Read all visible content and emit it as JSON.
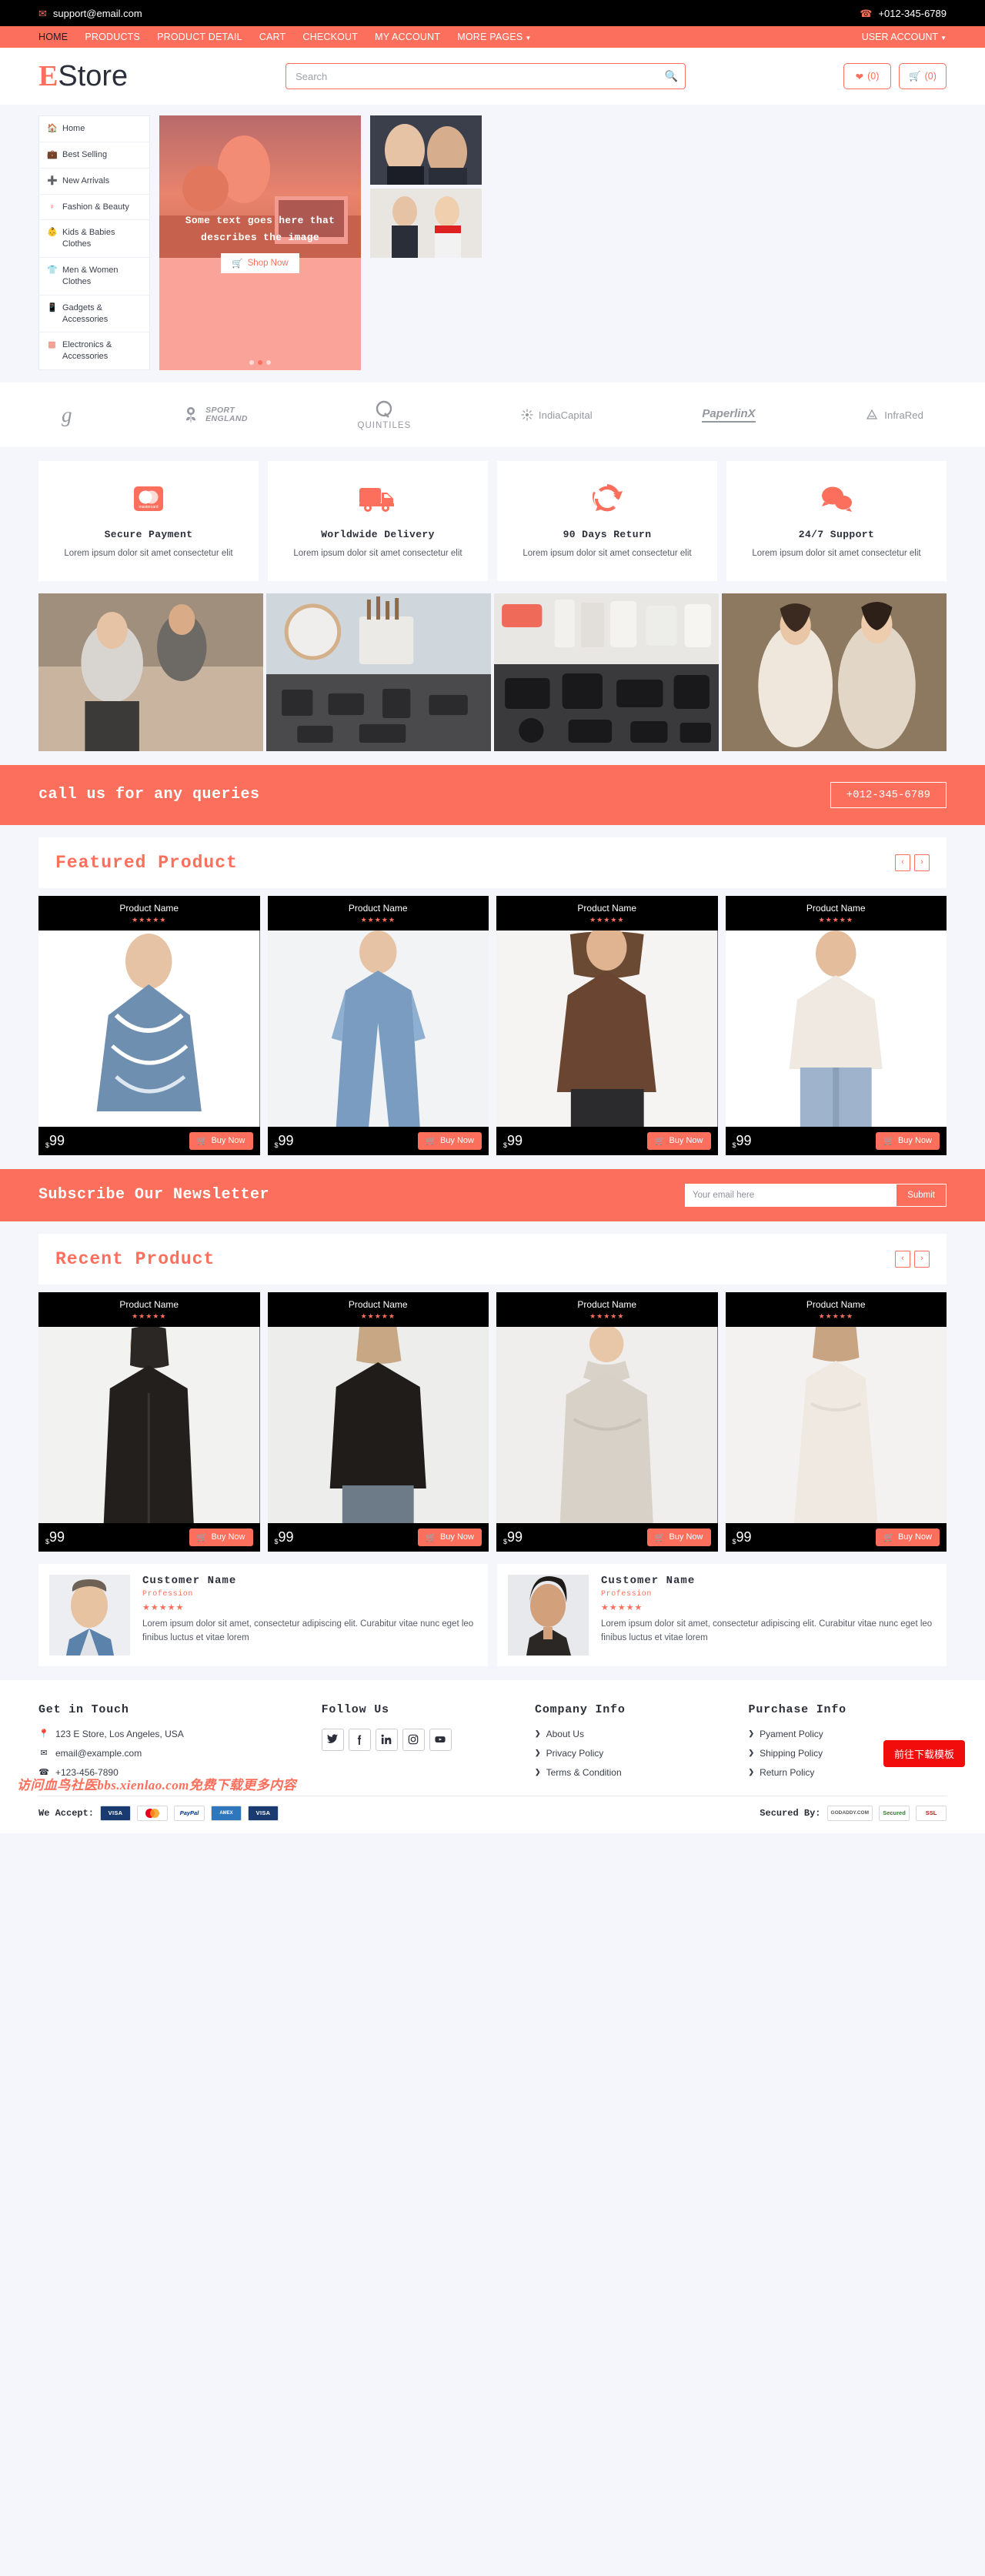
{
  "topbar": {
    "email": "support@email.com",
    "phone": "+012-345-6789",
    "email_icon": "envelope-icon",
    "phone_icon": "phone-icon"
  },
  "nav": {
    "links": [
      {
        "label": "HOME",
        "active": true
      },
      {
        "label": "PRODUCTS",
        "active": false
      },
      {
        "label": "PRODUCT DETAIL",
        "active": false
      },
      {
        "label": "CART",
        "active": false
      },
      {
        "label": "CHECKOUT",
        "active": false
      },
      {
        "label": "MY ACCOUNT",
        "active": false
      },
      {
        "label": "MORE PAGES",
        "active": false,
        "caret": true
      }
    ],
    "user_account": "USER ACCOUNT"
  },
  "header": {
    "logo_first": "E",
    "logo_rest": "Store",
    "search_placeholder": "Search",
    "search_value": "",
    "wishlist_count": "(0)",
    "cart_count": "(0)"
  },
  "categories": [
    {
      "label": "Home",
      "icon": "home-icon"
    },
    {
      "label": "Best Selling",
      "icon": "bag-icon"
    },
    {
      "label": "New Arrivals",
      "icon": "plus-square-icon"
    },
    {
      "label": "Fashion & Beauty",
      "icon": "female-icon"
    },
    {
      "label": "Kids & Babies Clothes",
      "icon": "child-icon"
    },
    {
      "label": "Men & Women Clothes",
      "icon": "tshirt-icon"
    },
    {
      "label": "Gadgets & Accessories",
      "icon": "mobile-icon"
    },
    {
      "label": "Electronics & Accessories",
      "icon": "microchip-icon"
    }
  ],
  "hero": {
    "text": "Some text goes here that describes the image",
    "cta": "Shop Now",
    "cta_icon": "cart-icon",
    "dots": 3,
    "active_dot": 2
  },
  "brands": [
    {
      "name": "",
      "kind": "script",
      "glyph": "g"
    },
    {
      "name": "SPORT ENGLAND",
      "kind": "sport"
    },
    {
      "name": "QUINTILES",
      "kind": "quintiles"
    },
    {
      "name": "IndiaCapital",
      "kind": "plain"
    },
    {
      "name": "PaperlinX",
      "kind": "paperlinx"
    },
    {
      "name": "InfraRed",
      "kind": "infrared"
    }
  ],
  "features": [
    {
      "title": "Secure Payment",
      "desc": "Lorem ipsum dolor sit amet consectetur elit",
      "icon": "mastercard-icon"
    },
    {
      "title": "Worldwide Delivery",
      "desc": "Lorem ipsum dolor sit amet consectetur elit",
      "icon": "truck-icon"
    },
    {
      "title": "90 Days Return",
      "desc": "Lorem ipsum dolor sit amet consectetur elit",
      "icon": "refresh-icon"
    },
    {
      "title": "24/7 Support",
      "desc": "Lorem ipsum dolor sit amet consectetur elit",
      "icon": "comments-icon"
    }
  ],
  "tiles": [
    {
      "name": "women-fashion-tile"
    },
    {
      "name": "beauty-makeup-tile"
    },
    {
      "name": "gadgets-electronics-tile"
    },
    {
      "name": "dresses-tile"
    }
  ],
  "call_banner": {
    "text": "call us for any queries",
    "phone": "+012-345-6789"
  },
  "featured": {
    "title": "Featured Product",
    "prev": "‹",
    "next": "›",
    "products": [
      {
        "name": "Product Name",
        "stars": "★★★★★",
        "currency": "$",
        "price": "99",
        "buy": "Buy Now"
      },
      {
        "name": "Product Name",
        "stars": "★★★★★",
        "currency": "$",
        "price": "99",
        "buy": "Buy Now"
      },
      {
        "name": "Product Name",
        "stars": "★★★★★",
        "currency": "$",
        "price": "99",
        "buy": "Buy Now"
      },
      {
        "name": "Product Name",
        "stars": "★★★★★",
        "currency": "$",
        "price": "99",
        "buy": "Buy Now"
      }
    ]
  },
  "newsletter": {
    "title": "Subscribe Our Newsletter",
    "placeholder": "Your email here",
    "value": "",
    "submit": "Submit"
  },
  "recent": {
    "title": "Recent Product",
    "prev": "‹",
    "next": "›",
    "products": [
      {
        "name": "Product Name",
        "stars": "★★★★★",
        "currency": "$",
        "price": "99",
        "buy": "Buy Now"
      },
      {
        "name": "Product Name",
        "stars": "★★★★★",
        "currency": "$",
        "price": "99",
        "buy": "Buy Now"
      },
      {
        "name": "Product Name",
        "stars": "★★★★★",
        "currency": "$",
        "price": "99",
        "buy": "Buy Now"
      },
      {
        "name": "Product Name",
        "stars": "★★★★★",
        "currency": "$",
        "price": "99",
        "buy": "Buy Now"
      }
    ]
  },
  "testimonials": [
    {
      "name": "Customer Name",
      "profession": "Profession",
      "stars": "★★★★★",
      "text": "Lorem ipsum dolor sit amet, consectetur adipiscing elit. Curabitur vitae nunc eget leo finibus luctus et vitae lorem"
    },
    {
      "name": "Customer Name",
      "profession": "Profession",
      "stars": "★★★★★",
      "text": "Lorem ipsum dolor sit amet, consectetur adipiscing elit. Curabitur vitae nunc eget leo finibus luctus et vitae lorem"
    }
  ],
  "footer": {
    "contact": {
      "title": "Get in Touch",
      "address": "123 E Store, Los Angeles, USA",
      "email": "email@example.com",
      "phone": "+123-456-7890"
    },
    "follow": {
      "title": "Follow Us",
      "socials": [
        "twitter-icon",
        "facebook-icon",
        "linkedin-icon",
        "instagram-icon",
        "youtube-icon"
      ]
    },
    "company": {
      "title": "Company Info",
      "links": [
        "About Us",
        "Privacy Policy",
        "Terms & Condition"
      ]
    },
    "purchase": {
      "title": "Purchase Info",
      "links": [
        "Pyament Policy",
        "Shipping Policy",
        "Return Policy"
      ]
    },
    "accept_label": "We Accept:",
    "accept_badges": [
      "VISA",
      "MC",
      "PayPal",
      "AMEX",
      "VISA"
    ],
    "secured_label": "Secured By:",
    "secured_badges": [
      "GODADDY.COM",
      "Secured",
      "SSL"
    ]
  },
  "watermark": {
    "text": "访问血鸟社医bbs.xienlao.com免费下载更多内容",
    "button": "前往下载模板"
  }
}
